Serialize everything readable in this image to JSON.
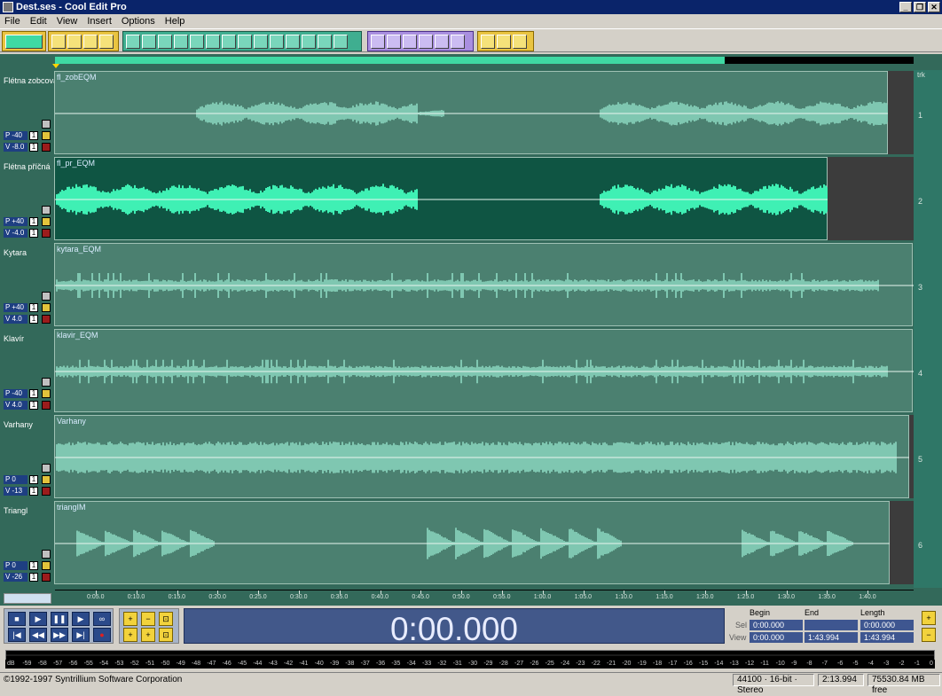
{
  "titlebar": {
    "title": "Dest.ses - Cool Edit Pro",
    "min_label": "_",
    "max_label": "❐",
    "close_label": "✕"
  },
  "menu": [
    "File",
    "Edit",
    "View",
    "Insert",
    "Options",
    "Help"
  ],
  "colors": {
    "lane_bg": "#4b8070",
    "lane_selected_bg": "#0f5543",
    "waveform": "#7fc7b1",
    "waveform_selected": "#3ff0b4",
    "envelope": "#eaf6f0",
    "overview_fill": "#3fd9a3"
  },
  "overview": {
    "viewed_fraction": 0.78
  },
  "ruler_header": "trk",
  "tracks": [
    {
      "name": "Flétna zobcová",
      "clip": "fl_zobEQM",
      "pan": "P -40",
      "vol": "V -8.0",
      "num": "1",
      "m": "1",
      "selected": false
    },
    {
      "name": "Flétna příčná",
      "clip": "fl_pr_EQM",
      "pan": "P +40",
      "vol": "V -4.0",
      "num": "2",
      "m": "1",
      "selected": true
    },
    {
      "name": "Kytara",
      "clip": "kytara_EQM",
      "pan": "P +40",
      "vol": "V 4.0",
      "num": "3",
      "m": "1",
      "selected": false
    },
    {
      "name": "Klavír",
      "clip": "klavir_EQM",
      "pan": "P -40",
      "vol": "V 4.0",
      "num": "4",
      "m": "1",
      "selected": false
    },
    {
      "name": "Varhany",
      "clip": "Varhany",
      "pan": "P 0",
      "vol": "V -13",
      "num": "5",
      "m": "1",
      "selected": false
    },
    {
      "name": "Triangl",
      "clip": "triangIM",
      "pan": "P 0",
      "vol": "V -26",
      "num": "6",
      "m": "1",
      "selected": false
    }
  ],
  "timeline": {
    "unit_label": "hms",
    "ticks": [
      "0:05.0",
      "0:10.0",
      "0:15.0",
      "0:20.0",
      "0:25.0",
      "0:30.0",
      "0:35.0",
      "0:40.0",
      "0:45.0",
      "0:50.0",
      "0:55.0",
      "1:00.0",
      "1:05.0",
      "1:10.0",
      "1:15.0",
      "1:20.0",
      "1:25.0",
      "1:30.0",
      "1:35.0",
      "1:40.0"
    ]
  },
  "transport": {
    "stop": "■",
    "play": "▶",
    "pause": "❚❚",
    "play_to_end": "▶",
    "loop": "∞",
    "goto_start": "|◀",
    "rewind": "◀◀",
    "forward": "▶▶",
    "goto_end": "▶|",
    "record": "●"
  },
  "zoom": {
    "in": "+",
    "out": "−",
    "full": "⊡",
    "in_left": "+",
    "in_right": "+",
    "sel": "⊡"
  },
  "time_display": "0:00.000",
  "selview": {
    "begin_header": "Begin",
    "end_header": "End",
    "length_header": "Length",
    "sel_label": "Sel",
    "view_label": "View",
    "sel_begin": "0:00.000",
    "sel_end": "",
    "sel_length": "0:00.000",
    "view_begin": "0:00.000",
    "view_end": "1:43.994",
    "view_length": "1:43.994"
  },
  "meter": {
    "ticks": [
      "dB",
      "-59",
      "-58",
      "-57",
      "-56",
      "-55",
      "-54",
      "-53",
      "-52",
      "-51",
      "-50",
      "-49",
      "-48",
      "-47",
      "-46",
      "-45",
      "-44",
      "-43",
      "-42",
      "-41",
      "-40",
      "-39",
      "-38",
      "-37",
      "-36",
      "-35",
      "-34",
      "-33",
      "-32",
      "-31",
      "-30",
      "-29",
      "-28",
      "-27",
      "-26",
      "-25",
      "-24",
      "-23",
      "-22",
      "-21",
      "-20",
      "-19",
      "-18",
      "-17",
      "-16",
      "-15",
      "-14",
      "-13",
      "-12",
      "-11",
      "-10",
      "-9",
      "-8",
      "-7",
      "-6",
      "-5",
      "-4",
      "-3",
      "-2",
      "-1",
      "0"
    ]
  },
  "status": {
    "copyright": "©1992-1997 Syntrillium Software Corporation",
    "format": "44100 · 16-bit · Stereo",
    "length": "2:13.994",
    "free": "75530.84 MB free"
  }
}
